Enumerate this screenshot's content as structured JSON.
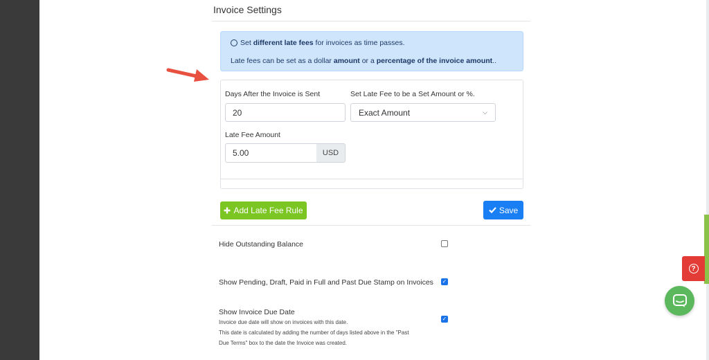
{
  "section": {
    "title": "Invoice Settings"
  },
  "info": {
    "line1": {
      "prefix": "Set ",
      "bold": "different late fees",
      "suffix": " for invoices as time passes."
    },
    "line2": {
      "prefix": "Late fees can be set as a dollar ",
      "bold1": "amount",
      "middle": " or a ",
      "bold2": "percentage of the invoice amount",
      "suffix": ".."
    }
  },
  "form": {
    "days_label": "Days After the Invoice is Sent",
    "days_value": "20",
    "type_label": "Set Late Fee to be a Set Amount or %.",
    "type_value": "Exact Amount",
    "amount_label": "Late Fee Amount",
    "amount_value": "5.00",
    "currency": "USD"
  },
  "buttons": {
    "add_rule": "Add Late Fee Rule",
    "save": "Save"
  },
  "options": [
    {
      "label": "Hide Outstanding Balance",
      "checked": false
    },
    {
      "label": "Show Pending, Draft, Paid in Full and Past Due Stamp on Invoices",
      "checked": true
    },
    {
      "label": "Show Invoice Due Date",
      "desc1": "Invoice due date will show on invoices with this date.",
      "desc2": "This date is calculated by adding the number of days listed above in the \"Past",
      "desc3": "Due Terms\" box to the date the Invoice was created.",
      "checked": true
    }
  ],
  "colors": {
    "info_bg": "#cfe5fc",
    "add_button": "#7cc623",
    "save_button": "#1a7ff5",
    "arrow": "#e8513f",
    "help_button": "#e33b36",
    "chat_button": "#5cb85c"
  },
  "icons": {
    "add": "plus-icon",
    "save": "check-icon",
    "help": "question-circle-icon",
    "chat": "chat-bubble-icon",
    "select": "chevron-down-icon"
  }
}
